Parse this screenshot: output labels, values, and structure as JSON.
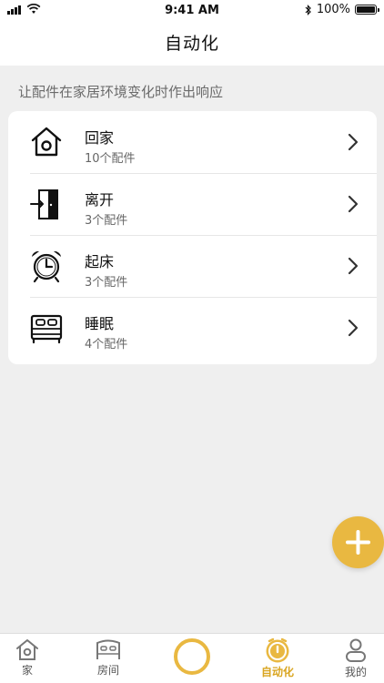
{
  "status": {
    "time": "9:41 AM",
    "battery": "100%",
    "battery_level": 1.0
  },
  "nav": {
    "title": "自动化"
  },
  "subtitle": "让配件在家居环境变化时作出响应",
  "scenes": [
    {
      "icon": "home-icon",
      "title": "回家",
      "sub": "10个配件"
    },
    {
      "icon": "door-exit-icon",
      "title": "离开",
      "sub": "3个配件"
    },
    {
      "icon": "alarm-clock-icon",
      "title": "起床",
      "sub": "3个配件"
    },
    {
      "icon": "bed-icon",
      "title": "睡眠",
      "sub": "4个配件"
    }
  ],
  "tabs": [
    {
      "icon": "home-tab-icon",
      "label": "家"
    },
    {
      "icon": "room-tab-icon",
      "label": "房间"
    },
    {
      "icon": "center-ring-icon",
      "label": ""
    },
    {
      "icon": "automation-tab-icon",
      "label": "自动化",
      "active": true
    },
    {
      "icon": "profile-tab-icon",
      "label": "我的"
    }
  ],
  "colors": {
    "accent": "#e9b841",
    "tab_active": "#d9a520"
  }
}
